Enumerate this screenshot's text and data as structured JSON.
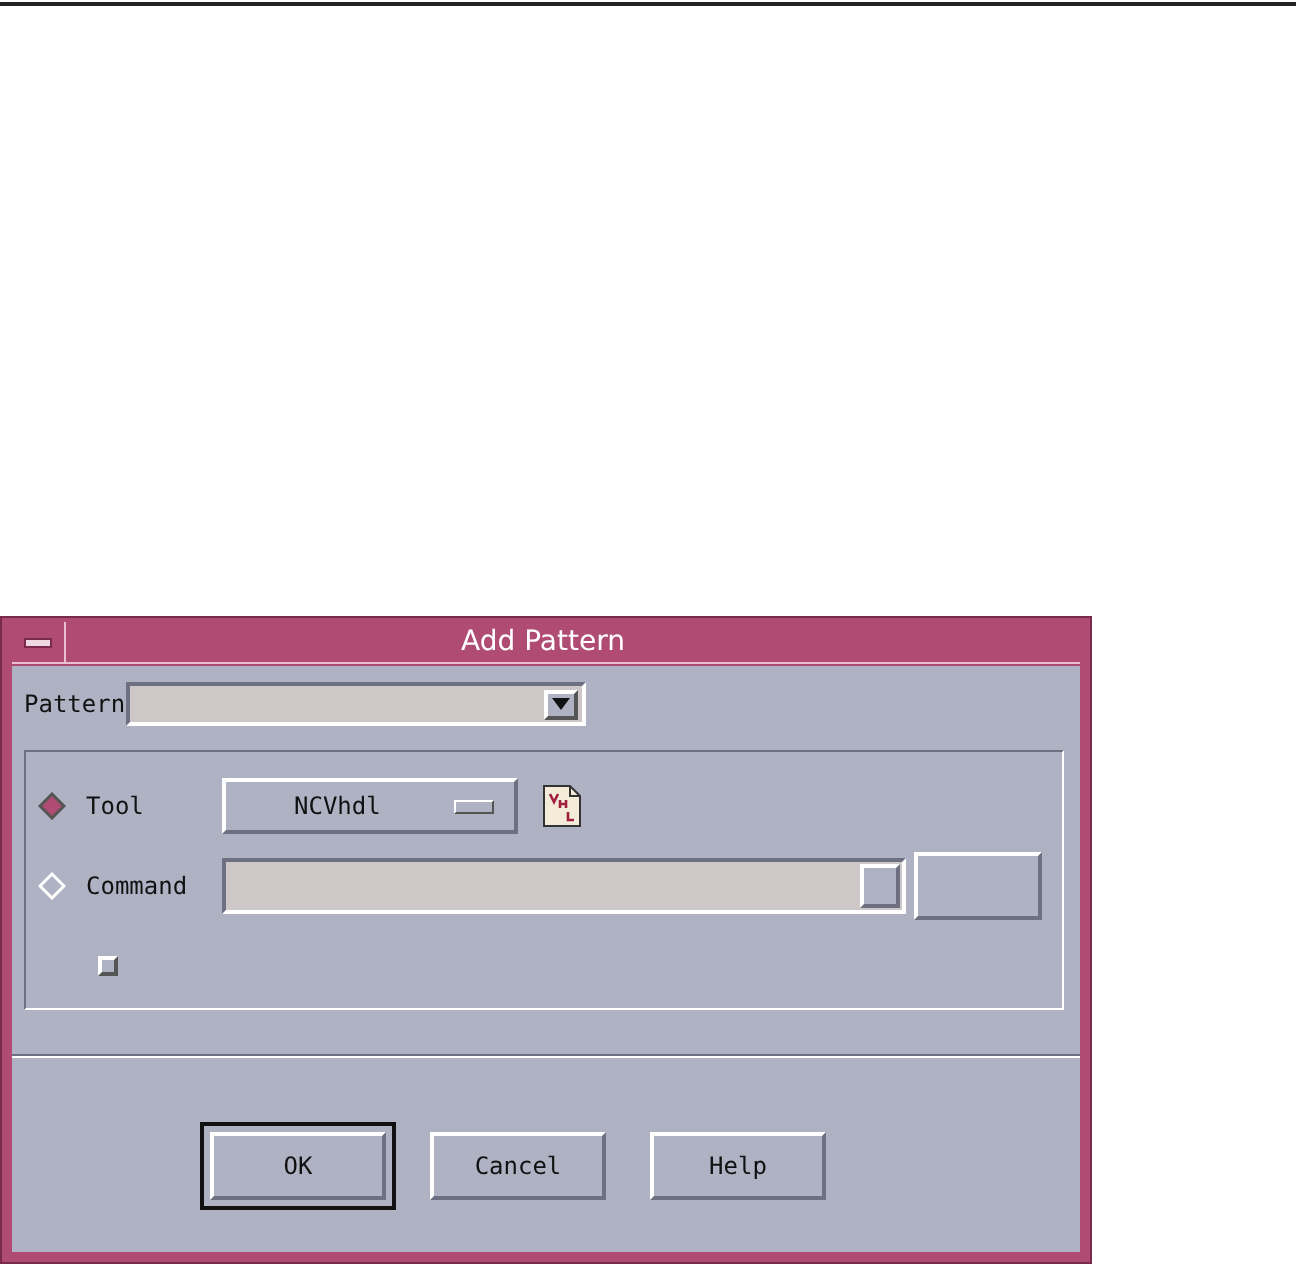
{
  "window": {
    "title": "Add Pattern"
  },
  "pattern": {
    "label": "Pattern"
  },
  "options": [
    {
      "kind": "menu",
      "label": "Tool",
      "selected": true,
      "value": "NCVhdl"
    },
    {
      "kind": "field",
      "label": "Command",
      "selected": false
    }
  ],
  "checkbox": {
    "checked": false
  },
  "buttons": [
    {
      "label": "OK",
      "default": true
    },
    {
      "label": "Cancel",
      "default": false
    },
    {
      "label": "Help",
      "default": false
    }
  ]
}
